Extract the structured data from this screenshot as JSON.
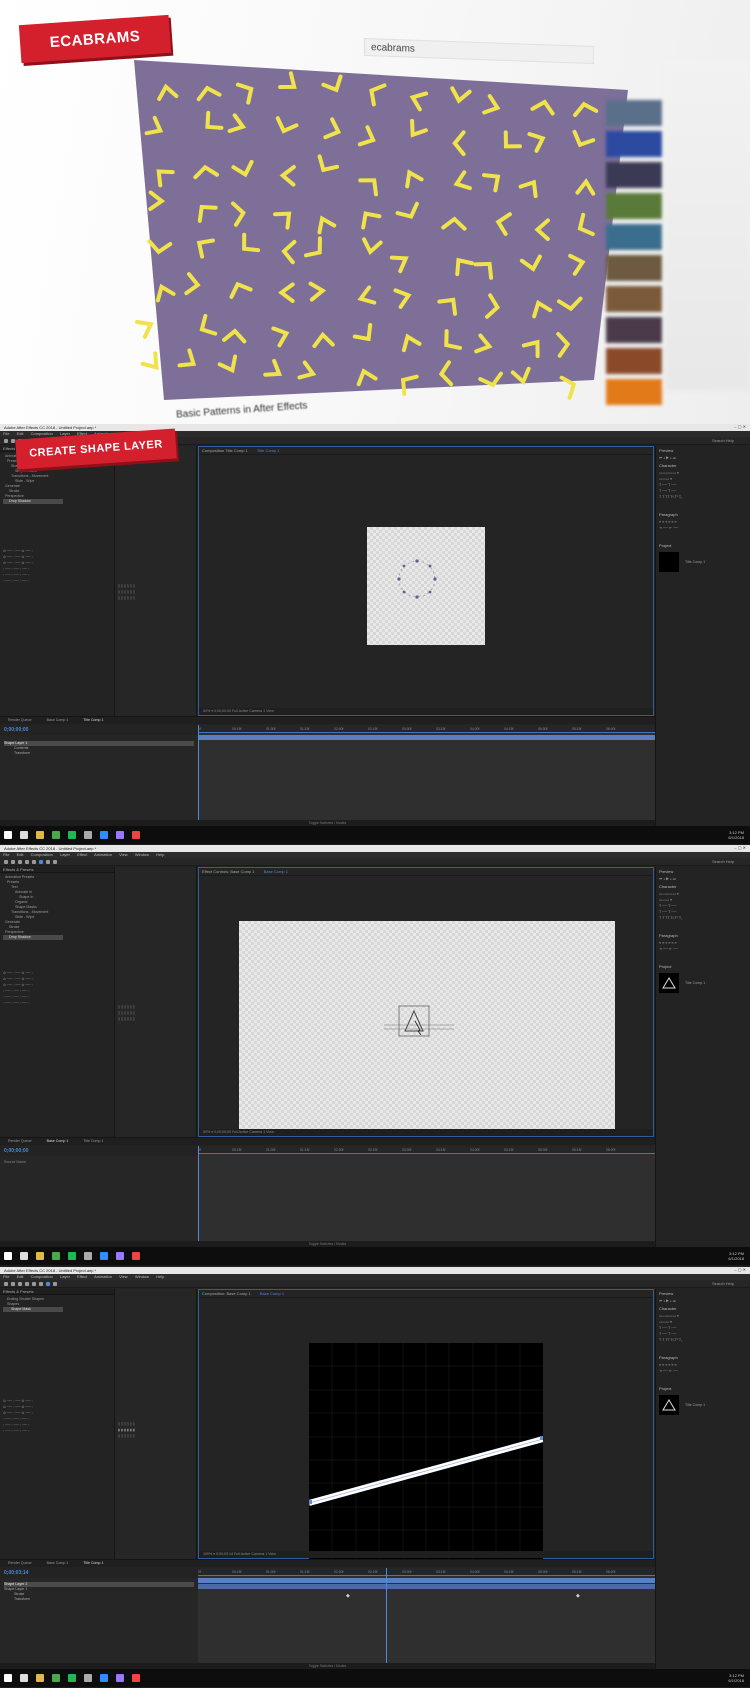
{
  "intro": {
    "badge": "ECABRAMS",
    "search_query": "ecabrams",
    "video_title": "Basic Patterns in After Effects",
    "colors": {
      "badge": "#d41f2d",
      "video_bg": "#7e6f99",
      "strokes": "#f0e34a"
    }
  },
  "app": {
    "title": "Adobe After Effects CC 2018 - Untitled Project.aep *",
    "window_buttons": "–   ▢   ✕",
    "menu": [
      "File",
      "Edit",
      "Composition",
      "Layer",
      "Effect",
      "Animation",
      "View",
      "Window",
      "Help"
    ],
    "search_help": "Search Help",
    "taskbar_time": "3:12 PM",
    "taskbar_date": "6/1/2018"
  },
  "panel2": {
    "banner": "CREATE SHAPE LAYER",
    "left_panel_title": "Effects & Presets",
    "tree": [
      "Animation Presets",
      "Presets",
      "Shapes",
      "Shape Masks",
      "Transitions - Movement",
      "Slide - Wipe",
      "Generate",
      "Stroke",
      "Perspective",
      "Drop Shadow"
    ],
    "comp_header": "Composition Title Comp 1",
    "comp_tab": "Title Comp 1",
    "comp_footer": "50%   ▾   0;00;00;00   Full   Active Camera   1 View",
    "tl_tabs": [
      "Render Queue",
      "Base Comp 1",
      "Title Comp 1"
    ],
    "timecode": "0;00;00;00",
    "layers": [
      "Shape Layer 1",
      "Contents",
      "Transform"
    ],
    "ruler": [
      "0f",
      "00:15f",
      "01:00f",
      "01:15f",
      "02:00f",
      "02:15f",
      "03:00f",
      "03:15f",
      "04:00f",
      "04:15f",
      "05:00f",
      "05:15f",
      "06:00f"
    ],
    "toggle": "Toggle Switches / Modes",
    "right": {
      "preview": "Preview",
      "character": "Character",
      "paragraph": "Paragraph",
      "project": "Project",
      "project_item": "Title Comp 1"
    }
  },
  "panel3": {
    "left_panel_title": "Effects & Presets",
    "tree": [
      "Animation Presets",
      "Presets",
      "Text",
      "Animate In",
      "Shape In",
      "Organic",
      "Shape Masks",
      "Transitions - Movement",
      "Slide - Wipe",
      "Generate",
      "Stroke",
      "Perspective",
      "Drop Shadow"
    ],
    "comp_header": "Effect Controls: Base Comp 1",
    "comp_tab": "Base Comp 1",
    "comp_footer": "50%   ▾   0;00;00;00   Full   Active Camera   1 View",
    "tl_tabs": [
      "Render Queue",
      "Base Comp 1",
      "Title Comp 1"
    ],
    "timecode": "0;00;00;00",
    "layers": [
      "Source Name"
    ],
    "ruler": [
      "0f",
      "00:15f",
      "01:00f",
      "01:15f",
      "02:00f",
      "02:15f",
      "03:00f",
      "03:15f",
      "04:00f",
      "04:15f",
      "05:00f",
      "05:15f",
      "06:00f"
    ],
    "toggle": "Toggle Switches / Modes",
    "right": {
      "preview": "Preview",
      "character": "Character",
      "paragraph": "Paragraph",
      "project": "Project",
      "project_item": "Title Comp 1"
    }
  },
  "panel4": {
    "left_panel_title": "Effects & Presets",
    "tree": [
      "Ending Shutter Shapes",
      "Shapes",
      "Shape Mask"
    ],
    "comp_header": "Composition: Base Comp 1",
    "comp_tab": "Base Comp 1",
    "comp_footer": "100%   ▾   0;00;03;14   Full   Active Camera   1 View",
    "tl_tabs": [
      "Render Queue",
      "Base Comp 1",
      "Title Comp 1"
    ],
    "timecode": "0;00;03;14",
    "layers": [
      "Shape Layer 2",
      "Shape Layer 1",
      "Stroke",
      "Transform"
    ],
    "ruler": [
      "0f",
      "00:15f",
      "01:00f",
      "01:15f",
      "02:00f",
      "02:15f",
      "03:00f",
      "03:15f",
      "04:00f",
      "04:15f",
      "05:00f",
      "05:15f",
      "06:00f"
    ],
    "toggle": "Toggle Switches / Modes",
    "right": {
      "preview": "Preview",
      "character": "Character",
      "paragraph": "Paragraph",
      "project": "Project",
      "project_item": "Title Comp 1"
    }
  }
}
